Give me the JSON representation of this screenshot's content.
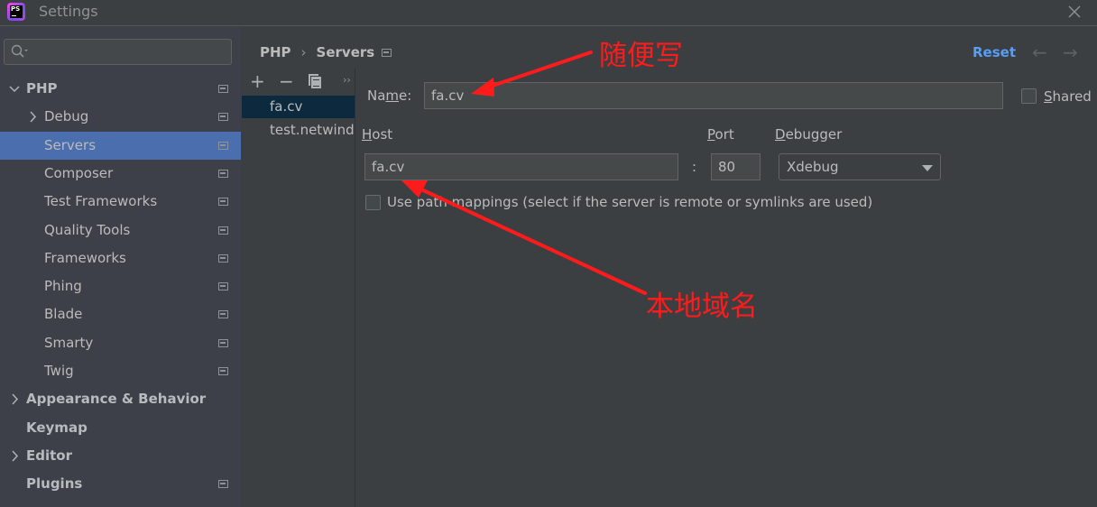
{
  "window": {
    "title": "Settings",
    "app_icon": "phpstorm-logo-icon",
    "app_icon_text": "PS",
    "close_icon": "close-icon"
  },
  "sidebar": {
    "search": {
      "placeholder": "",
      "value": "",
      "icon": "search-icon"
    },
    "items": [
      {
        "label": "PHP",
        "level": 0,
        "expanded": true,
        "bold": true,
        "project_icon": true,
        "selected": false
      },
      {
        "label": "Debug",
        "level": 1,
        "expandable": true,
        "expanded": false,
        "project_icon": true,
        "selected": false
      },
      {
        "label": "Servers",
        "level": 1,
        "project_icon": true,
        "selected": true
      },
      {
        "label": "Composer",
        "level": 1,
        "project_icon": true,
        "selected": false
      },
      {
        "label": "Test Frameworks",
        "level": 1,
        "project_icon": true,
        "selected": false
      },
      {
        "label": "Quality Tools",
        "level": 1,
        "project_icon": true,
        "selected": false
      },
      {
        "label": "Frameworks",
        "level": 1,
        "project_icon": true,
        "selected": false
      },
      {
        "label": "Phing",
        "level": 1,
        "project_icon": true,
        "selected": false
      },
      {
        "label": "Blade",
        "level": 1,
        "project_icon": true,
        "selected": false
      },
      {
        "label": "Smarty",
        "level": 1,
        "project_icon": true,
        "selected": false
      },
      {
        "label": "Twig",
        "level": 1,
        "project_icon": true,
        "selected": false
      },
      {
        "label": "Appearance & Behavior",
        "level": 0,
        "expandable": true,
        "expanded": false,
        "bold": true,
        "project_icon": false,
        "selected": false
      },
      {
        "label": "Keymap",
        "level": 0,
        "bold": true,
        "project_icon": false,
        "selected": false
      },
      {
        "label": "Editor",
        "level": 0,
        "expandable": true,
        "expanded": false,
        "bold": true,
        "project_icon": false,
        "selected": false
      },
      {
        "label": "Plugins",
        "level": 0,
        "bold": true,
        "project_icon": true,
        "selected": false
      }
    ]
  },
  "breadcrumb": {
    "items": [
      "PHP",
      "Servers"
    ],
    "separator": "›"
  },
  "header": {
    "reset_label": "Reset",
    "back_icon": "←",
    "forward_icon": "→"
  },
  "servers_toolbar": {
    "add": "+",
    "remove": "−",
    "more": "››"
  },
  "servers_list": [
    {
      "name": "fa.cv",
      "selected": true
    },
    {
      "name": "test.netwind.",
      "selected": false
    }
  ],
  "form": {
    "name_label_pre": "Na",
    "name_label_mn": "m",
    "name_label_post": "e:",
    "name_value": "fa.cv",
    "shared_label_mn": "S",
    "shared_label_rest": "hared",
    "shared_checked": false,
    "host_label_mn": "H",
    "host_label_rest": "ost",
    "host_value": "fa.cv",
    "port_label_mn": "P",
    "port_label_rest": "ort",
    "port_value": "80",
    "colon": ":",
    "debugger_label_mn": "D",
    "debugger_label_rest": "ebugger",
    "debugger_value": "Xdebug",
    "path_mappings_label": "Use path mappings (select if the server is remote or symlinks are used)",
    "path_mappings_checked": false
  },
  "annotations": {
    "name_note": "随便写",
    "host_note": "本地域名",
    "color": "#ff1b1b"
  }
}
